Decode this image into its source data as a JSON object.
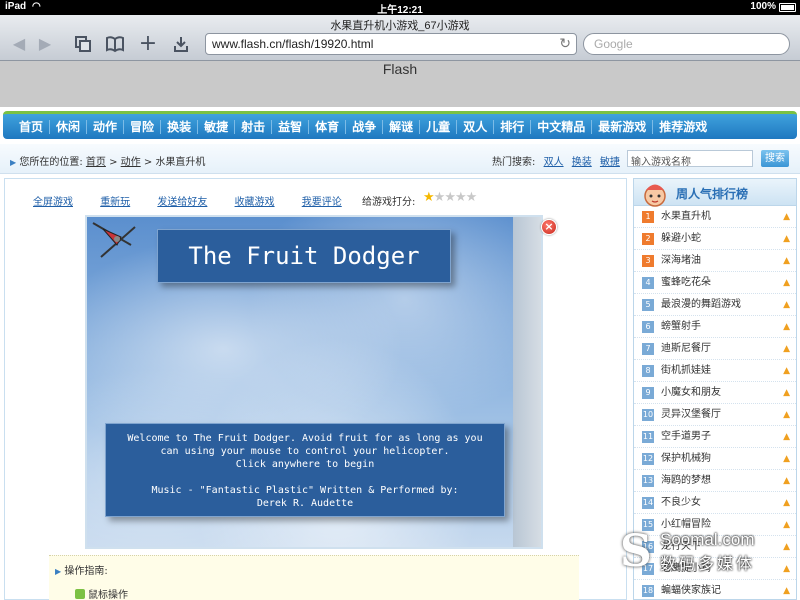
{
  "status_bar": {
    "carrier": "iPad",
    "time": "上午12:21",
    "battery": "100%"
  },
  "browser": {
    "page_title": "水果直升机小游戏_67小游戏",
    "url": "www.flash.cn/flash/19920.html",
    "search_placeholder": "Google"
  },
  "flash_label": "Flash",
  "nav": [
    "首页",
    "休闲",
    "动作",
    "冒险",
    "换装",
    "敏捷",
    "射击",
    "益智",
    "体育",
    "战争",
    "解谜",
    "儿童",
    "双人",
    "排行",
    "中文精品",
    "最新游戏",
    "推荐游戏"
  ],
  "breadcrumb": {
    "prefix": "您所在的位置:",
    "home": "首页",
    "sep1": ">",
    "category": "动作",
    "sep2": ">",
    "current": "水果直升机"
  },
  "hot_search": {
    "label": "热门搜索:",
    "links": [
      "双人",
      "换装",
      "敏捷"
    ],
    "input_placeholder": "输入游戏名称",
    "button": "搜索"
  },
  "actions": [
    "全屏游戏",
    "重新玩",
    "发送给好友",
    "收藏游戏",
    "我要评论"
  ],
  "rating": {
    "label": "给游戏打分:",
    "stars_total": 5,
    "stars_filled": 1
  },
  "game": {
    "title": "The Fruit Dodger",
    "info_lines": [
      "Welcome to The Fruit Dodger. Avoid fruit for as long as you",
      "can using your mouse to control your helicopter.",
      "Click anywhere to begin",
      "",
      "Music - \"Fantastic Plastic\" Written & Performed by:",
      "Derek R. Audette"
    ]
  },
  "guide": {
    "label": "操作指南:",
    "mouse": "鼠标操作"
  },
  "ranking": {
    "title": "周人气排行榜",
    "items": [
      {
        "rank": "1",
        "name": "水果直升机"
      },
      {
        "rank": "2",
        "name": "躲避小蛇"
      },
      {
        "rank": "3",
        "name": "深海堵油"
      },
      {
        "rank": "4",
        "name": "蜜蜂吃花朵"
      },
      {
        "rank": "5",
        "name": "最浪漫的舞蹈游戏"
      },
      {
        "rank": "6",
        "name": "螃蟹射手"
      },
      {
        "rank": "7",
        "name": "迪斯尼餐厅"
      },
      {
        "rank": "8",
        "name": "街机抓娃娃"
      },
      {
        "rank": "9",
        "name": "小魔女和朋友"
      },
      {
        "rank": "10",
        "name": "灵异汉堡餐厅"
      },
      {
        "rank": "11",
        "name": "空手道男子"
      },
      {
        "rank": "12",
        "name": "保护机械狗"
      },
      {
        "rank": "13",
        "name": "海鸥的梦想"
      },
      {
        "rank": "14",
        "name": "不良少女"
      },
      {
        "rank": "15",
        "name": "小红帽冒险"
      },
      {
        "rank": "16",
        "name": "龙行天下"
      },
      {
        "rank": "17",
        "name": "老鹰捉小鸡"
      },
      {
        "rank": "18",
        "name": "蝙蝠侠家族记"
      }
    ]
  },
  "watermark": {
    "line1": "Soomal.com",
    "line2": "数码多媒体"
  }
}
